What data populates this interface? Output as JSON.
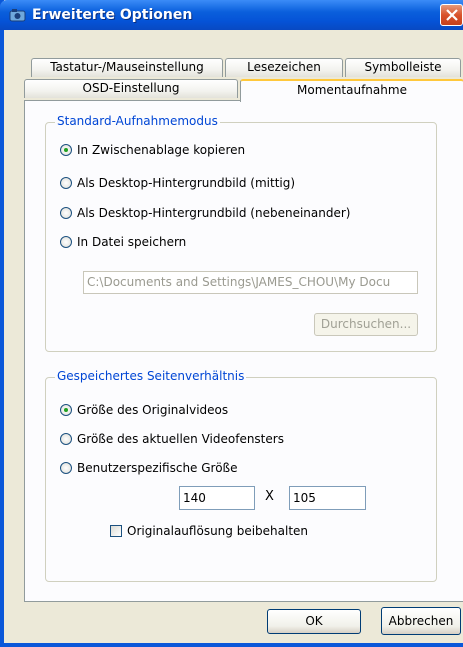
{
  "window": {
    "title": "Erweiterte Optionen",
    "icons": {
      "app": "app-icon",
      "close": "close-icon"
    }
  },
  "tabs": {
    "row_top": [
      "Tastatur-/Mauseinstellung",
      "Lesezeichen",
      "Symbolleiste"
    ],
    "row_bottom": [
      "OSD-Einstellung",
      "Momentaufnahme"
    ],
    "selected": "Momentaufnahme"
  },
  "capture_mode": {
    "legend": "Standard-Aufnahmemodus",
    "options": [
      "In Zwischenablage kopieren",
      "Als Desktop-Hintergrundbild (mittig)",
      "Als Desktop-Hintergrundbild (nebeneinander)",
      "In Datei speichern"
    ],
    "selected": "In Zwischenablage kopieren",
    "path_value": "C:\\Documents and Settings\\JAMES_CHOU\\My Docu",
    "browse_label": "Durchsuchen..."
  },
  "aspect_ratio": {
    "legend": "Gespeichertes Seitenverhältnis",
    "options": [
      "Größe des Originalvideos",
      "Größe des aktuellen Videofensters",
      "Benutzerspezifische Größe"
    ],
    "selected": "Größe des Originalvideos",
    "width_value": "140",
    "separator": "X",
    "height_value": "105",
    "keep_resolution_label": "Originalauflösung beibehalten",
    "keep_resolution_checked": false
  },
  "buttons": {
    "ok": "OK",
    "cancel": "Abbrechen"
  },
  "colors": {
    "titlebar": "#0553d7",
    "close_button": "#d9532c",
    "group_legend": "#0046d5",
    "selected_tab_accent": "#ffc83c",
    "radio_dot": "#21a121"
  }
}
